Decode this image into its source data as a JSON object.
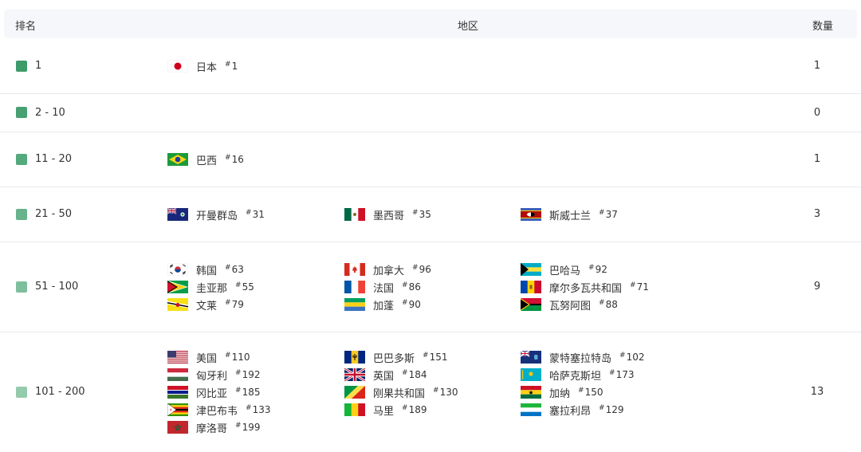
{
  "header": {
    "rank": "排名",
    "region": "地区",
    "count": "数量"
  },
  "rows": [
    {
      "rank": "1",
      "count": "1",
      "color": "#3d9a6a",
      "regions": [
        {
          "name": "日本",
          "num": "1",
          "flag": "japan-flag-icon"
        }
      ]
    },
    {
      "rank": "2 - 10",
      "count": "0",
      "color": "#46a072",
      "regions": []
    },
    {
      "rank": "11 - 20",
      "count": "1",
      "color": "#54a97e",
      "regions": [
        {
          "name": "巴西",
          "num": "16",
          "flag": "brazil-flag-icon"
        }
      ]
    },
    {
      "rank": "21 - 50",
      "count": "3",
      "color": "#66b38c",
      "regions": [
        {
          "name": "开曼群岛",
          "num": "31",
          "flag": "cayman-islands-flag-icon"
        },
        {
          "name": "墨西哥",
          "num": "35",
          "flag": "mexico-flag-icon"
        },
        {
          "name": "斯威士兰",
          "num": "37",
          "flag": "eswatini-flag-icon"
        }
      ]
    },
    {
      "rank": "51 - 100",
      "count": "9",
      "color": "#7dbf9c",
      "regions": [
        {
          "name": "韩国",
          "num": "63",
          "flag": "south-korea-flag-icon"
        },
        {
          "name": "加拿大",
          "num": "96",
          "flag": "canada-flag-icon"
        },
        {
          "name": "巴哈马",
          "num": "92",
          "flag": "bahamas-flag-icon"
        },
        {
          "name": "圭亚那",
          "num": "55",
          "flag": "guyana-flag-icon"
        },
        {
          "name": "法国",
          "num": "86",
          "flag": "france-flag-icon"
        },
        {
          "name": "摩尔多瓦共和国",
          "num": "71",
          "flag": "moldova-flag-icon"
        },
        {
          "name": "文莱",
          "num": "79",
          "flag": "brunei-flag-icon"
        },
        {
          "name": "加蓬",
          "num": "90",
          "flag": "gabon-flag-icon"
        },
        {
          "name": "瓦努阿图",
          "num": "88",
          "flag": "vanuatu-flag-icon"
        }
      ]
    },
    {
      "rank": "101 - 200",
      "count": "13",
      "color": "#93cbac",
      "regions": [
        {
          "name": "美国",
          "num": "110",
          "flag": "usa-flag-icon"
        },
        {
          "name": "巴巴多斯",
          "num": "151",
          "flag": "barbados-flag-icon"
        },
        {
          "name": "蒙特塞拉特岛",
          "num": "102",
          "flag": "montserrat-flag-icon"
        },
        {
          "name": "匈牙利",
          "num": "192",
          "flag": "hungary-flag-icon"
        },
        {
          "name": "英国",
          "num": "184",
          "flag": "uk-flag-icon"
        },
        {
          "name": "哈萨克斯坦",
          "num": "173",
          "flag": "kazakhstan-flag-icon"
        },
        {
          "name": "冈比亚",
          "num": "185",
          "flag": "gambia-flag-icon"
        },
        {
          "name": "刚果共和国",
          "num": "130",
          "flag": "congo-flag-icon"
        },
        {
          "name": "加纳",
          "num": "150",
          "flag": "ghana-flag-icon"
        },
        {
          "name": "津巴布韦",
          "num": "133",
          "flag": "zimbabwe-flag-icon"
        },
        {
          "name": "马里",
          "num": "189",
          "flag": "mali-flag-icon"
        },
        {
          "name": "塞拉利昂",
          "num": "129",
          "flag": "sierra-leone-flag-icon"
        },
        {
          "name": "摩洛哥",
          "num": "199",
          "flag": "morocco-flag-icon"
        }
      ]
    }
  ]
}
